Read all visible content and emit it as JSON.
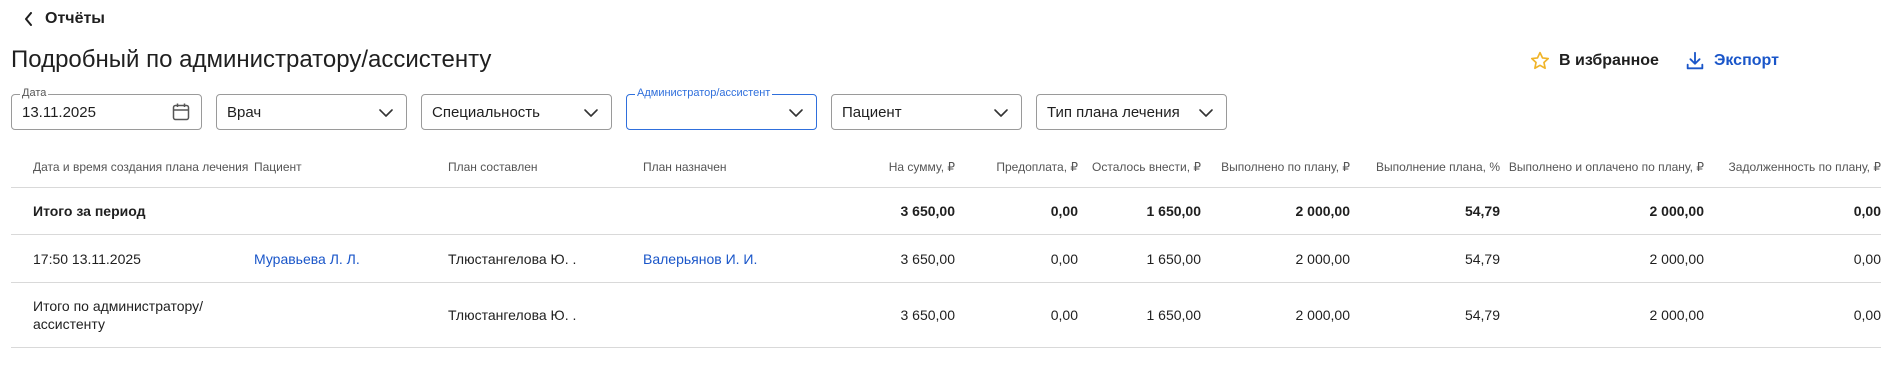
{
  "nav": {
    "back_label": "Отчёты"
  },
  "page": {
    "title": "Подробный по администратору/ассистенту"
  },
  "actions": {
    "favorite_label": "В избранное",
    "export_label": "Экспорт"
  },
  "filters": {
    "date": {
      "label": "Дата",
      "value": "13.11.2025"
    },
    "doctor": {
      "placeholder": "Врач"
    },
    "specialty": {
      "placeholder": "Специальность"
    },
    "admin": {
      "label": "Администратор/ассистент",
      "value": ""
    },
    "patient": {
      "placeholder": "Пациент"
    },
    "plan_type": {
      "placeholder": "Тип плана лечения"
    }
  },
  "table": {
    "columns": [
      "Дата и время создания плана лечения",
      "Пациент",
      "План составлен",
      "План назначен",
      "На сумму, ₽",
      "Предоплата, ₽",
      "Осталось внести, ₽",
      "Выполнено по плану, ₽",
      "Выполнение плана, %",
      "Выполнено и оплачено по плану, ₽",
      "Задолженность по плану, ₽"
    ],
    "total": {
      "label": "Итого за период",
      "sum": "3 650,00",
      "prepaid": "0,00",
      "remaining": "1 650,00",
      "done": "2 000,00",
      "percent": "54,79",
      "done_paid": "2 000,00",
      "debt": "0,00"
    },
    "rows": [
      {
        "datetime": "17:50 13.11.2025",
        "patient": "Муравьева Л. Л.",
        "composed_by": "Тлюстангелова Ю. .",
        "assigned_to": "Валерьянов И. И.",
        "sum": "3 650,00",
        "prepaid": "0,00",
        "remaining": "1 650,00",
        "done": "2 000,00",
        "percent": "54,79",
        "done_paid": "2 000,00",
        "debt": "0,00"
      }
    ],
    "admin_total": {
      "label": "Итого по администратору/ ассистенту",
      "composed_by": "Тлюстангелова Ю. .",
      "sum": "3 650,00",
      "prepaid": "0,00",
      "remaining": "1 650,00",
      "done": "2 000,00",
      "percent": "54,79",
      "done_paid": "2 000,00",
      "debt": "0,00"
    }
  },
  "colors": {
    "accent": "#1a56c9",
    "focus": "#2f6fdc",
    "star": "#f0b429",
    "border": "#9a9a9a"
  }
}
